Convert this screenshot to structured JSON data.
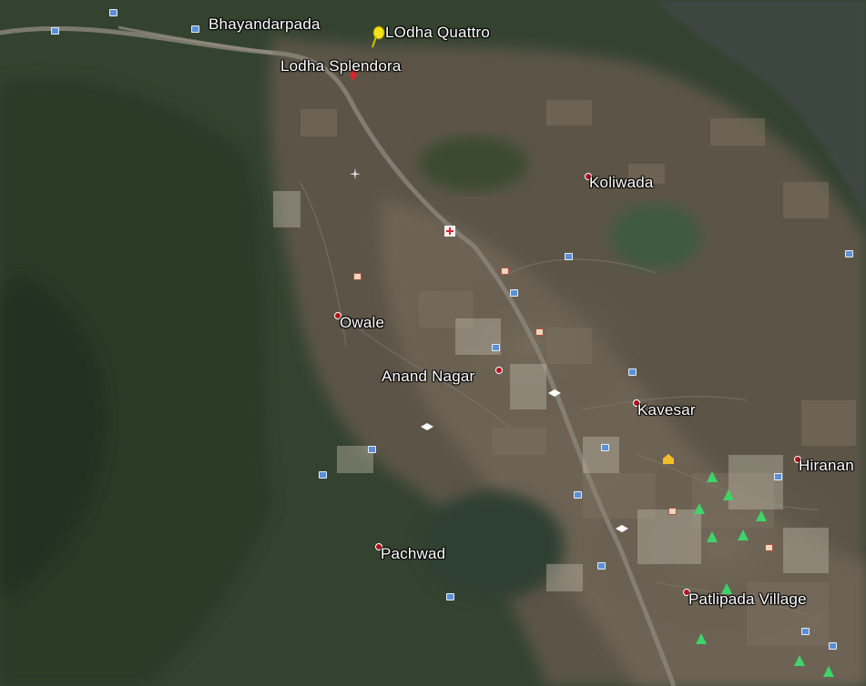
{
  "map": {
    "view": "satellite",
    "places": [
      {
        "name": "Bhayandarpada",
        "type": "place-label"
      },
      {
        "name": "LOdha Quattro",
        "type": "pushpin"
      },
      {
        "name": "Lodha Splendora",
        "type": "landmark"
      },
      {
        "name": "Koliwada",
        "type": "village"
      },
      {
        "name": "Owale",
        "type": "village"
      },
      {
        "name": "Anand Nagar",
        "type": "village"
      },
      {
        "name": "Kavesar",
        "type": "village"
      },
      {
        "name": "Hiranan",
        "type": "place-label"
      },
      {
        "name": "Pachwad",
        "type": "village"
      },
      {
        "name": "Patlipada Village",
        "type": "village"
      }
    ],
    "colors": {
      "forest": "#2f3f2b",
      "urban": "#6b6152",
      "water": "#3a4542",
      "road": "#8a8478",
      "village_marker": "#b3121f",
      "pushpin": "#f2e21a",
      "park_icon": "#3fd46b",
      "poi_icon": "#5b8fd6"
    }
  }
}
